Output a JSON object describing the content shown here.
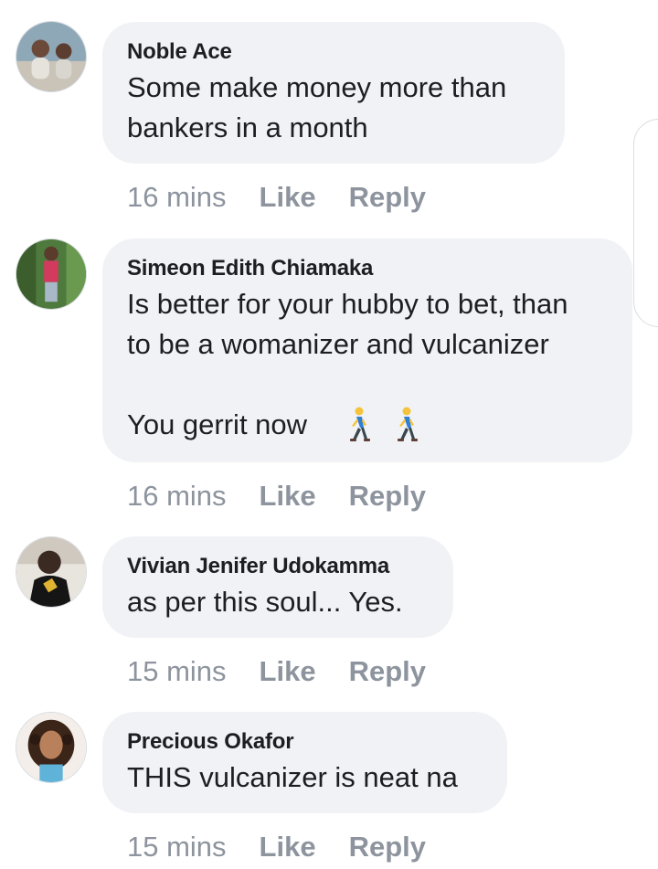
{
  "comments": [
    {
      "author": "Noble Ace",
      "text": "Some make money more than\nbankers in a month",
      "time": "16 mins",
      "like_label": "Like",
      "reply_label": "Reply"
    },
    {
      "author": "Simeon Edith Chiamaka",
      "text": "Is better for your hubby to bet, than\nto be a womanizer and vulcanizer\n\nYou gerrit now",
      "emoji": [
        "person-walking-icon",
        "person-walking-icon"
      ],
      "time": "16 mins",
      "like_label": "Like",
      "reply_label": "Reply"
    },
    {
      "author": "Vivian Jenifer Udokamma",
      "text": "as per this soul... Yes.",
      "time": "15 mins",
      "like_label": "Like",
      "reply_label": "Reply"
    },
    {
      "author": "Precious Okafor",
      "text": "THIS vulcanizer is neat na",
      "time": "15 mins",
      "like_label": "Like",
      "reply_label": "Reply"
    }
  ],
  "colors": {
    "bubble": "#f0f2f5",
    "author_text": "#1c1e21",
    "meta_text": "#8d949e"
  }
}
